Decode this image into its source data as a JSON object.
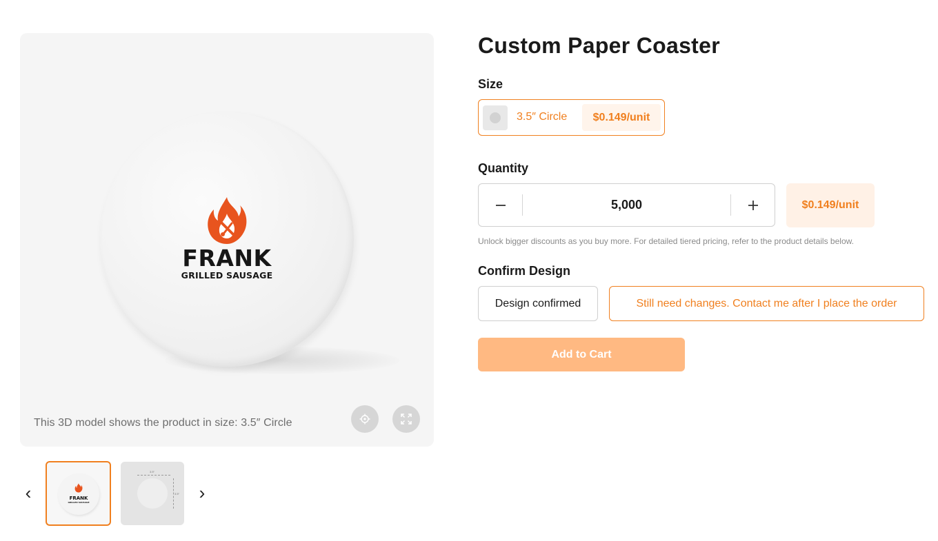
{
  "product": {
    "title": "Custom Paper Coaster"
  },
  "viewer": {
    "caption": "This 3D model shows the product in size: 3.5″ Circle",
    "logo": {
      "name": "FRANK",
      "tagline": "GRILLED SAUSAGE"
    },
    "buttons": [
      {
        "icon": "target-icon"
      },
      {
        "icon": "expand-icon"
      }
    ]
  },
  "gallery": {
    "prev_icon": "‹",
    "next_icon": "›",
    "thumbnails": [
      {
        "name": "FRANK",
        "tagline": "GRILLED SAUSAGE",
        "selected": true
      },
      {
        "dimension_label_h": "3.5″",
        "dimension_label_v": "3.5″",
        "selected": false
      }
    ]
  },
  "size": {
    "label": "Size",
    "options": [
      {
        "name": "3.5″ Circle",
        "price": "$0.149/unit",
        "selected": true
      }
    ]
  },
  "quantity": {
    "label": "Quantity",
    "value": "5,000",
    "unit_price": "$0.149/unit",
    "note": "Unlock bigger discounts as you buy more. For detailed tiered pricing, refer to the product details below."
  },
  "confirm_design": {
    "label": "Confirm Design",
    "options": [
      {
        "label": "Design confirmed",
        "selected": false
      },
      {
        "label": "Still need changes. Contact me after I place the order",
        "selected": true
      }
    ]
  },
  "cart": {
    "button_label": "Add to Cart"
  },
  "colors": {
    "accent": "#f07f1e",
    "accent_light": "#fff1e6",
    "cart_button": "#ffb982",
    "flame": "#e8541e"
  }
}
